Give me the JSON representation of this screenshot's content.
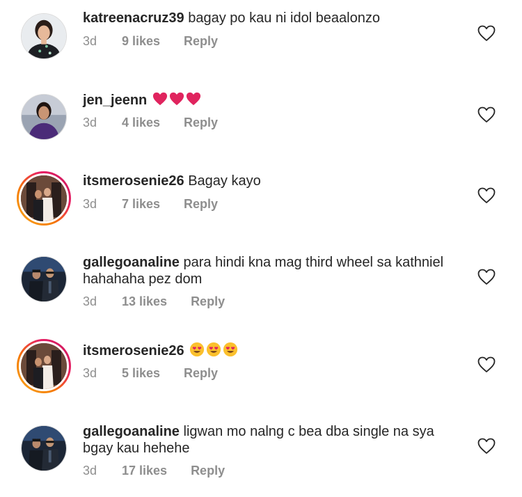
{
  "comments": [
    {
      "username": "katreenacruz39",
      "text": "bagay po kau ni idol beaalonzo",
      "text_line2": "",
      "time": "3d",
      "likes": "9 likes",
      "reply": "Reply",
      "avatar": "avatar-woman-portrait",
      "story_ring": false,
      "emoji": ""
    },
    {
      "username": "jen_jeenn",
      "text": "",
      "text_line2": "",
      "time": "3d",
      "likes": "4 likes",
      "reply": "Reply",
      "avatar": "avatar-woman-purple",
      "story_ring": false,
      "emoji": "red-heart x3"
    },
    {
      "username": "itsmerosenie26",
      "text": "Bagay kayo",
      "text_line2": "",
      "time": "3d",
      "likes": "7 likes",
      "reply": "Reply",
      "avatar": "avatar-couple-photo",
      "story_ring": true,
      "emoji": ""
    },
    {
      "username": "gallegoanaline",
      "text": "para hindi kna mag third wheel sa kathniel",
      "text_line2": "hahahaha pez dom",
      "time": "3d",
      "likes": "13 likes",
      "reply": "Reply",
      "avatar": "avatar-two-men",
      "story_ring": false,
      "emoji": ""
    },
    {
      "username": "itsmerosenie26",
      "text": "",
      "text_line2": "",
      "time": "3d",
      "likes": "5 likes",
      "reply": "Reply",
      "avatar": "avatar-couple-photo",
      "story_ring": true,
      "emoji": "heart-eyes x3"
    },
    {
      "username": "gallegoanaline",
      "text": "ligwan mo nalng c bea dba single na sya",
      "text_line2": "bgay kau hehehe",
      "time": "3d",
      "likes": "17 likes",
      "reply": "Reply",
      "avatar": "avatar-two-men",
      "story_ring": false,
      "emoji": ""
    }
  ],
  "colors": {
    "text": "#262626",
    "meta": "#8e8e8e",
    "heart_emoji": "#e0245e",
    "story_ring_start": "#f9a825",
    "story_ring_end": "#c2185b"
  }
}
